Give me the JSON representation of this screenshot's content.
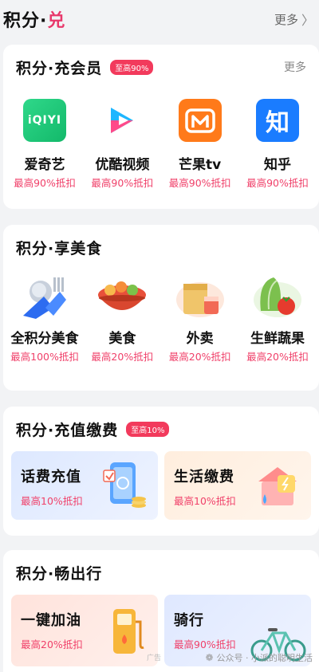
{
  "header": {
    "title_main": "积分·",
    "title_accent": "兑",
    "more": "更多"
  },
  "vip": {
    "title": "积分·充会员",
    "badge": "至高90%",
    "more": "更多",
    "items": [
      {
        "name": "爱奇艺",
        "sub": "最高90%抵扣",
        "icon": "iqiyi-logo",
        "logo_text": "iQIYI"
      },
      {
        "name": "优酷视频",
        "sub": "最高90%抵扣",
        "icon": "youku-logo"
      },
      {
        "name": "芒果tv",
        "sub": "最高90%抵扣",
        "icon": "mango-tv-logo"
      },
      {
        "name": "知乎",
        "sub": "最高90%抵扣",
        "icon": "zhihu-logo",
        "logo_text": "知"
      }
    ]
  },
  "food": {
    "title": "积分·享美食",
    "items": [
      {
        "name": "全积分美食",
        "sub": "最高100%抵扣",
        "icon": "spoon-fork-icon"
      },
      {
        "name": "美食",
        "sub": "最高20%抵扣",
        "icon": "food-bowl-icon"
      },
      {
        "name": "外卖",
        "sub": "最高20%抵扣",
        "icon": "takeout-bag-icon"
      },
      {
        "name": "生鲜蔬果",
        "sub": "最高20%抵扣",
        "icon": "vegetables-icon"
      }
    ]
  },
  "bills": {
    "title": "积分·充值缴费",
    "badge": "至高10%",
    "tiles": [
      {
        "name": "话费充值",
        "sub": "最高10%抵扣",
        "icon": "phone-recharge-icon"
      },
      {
        "name": "生活缴费",
        "sub": "最高10%抵扣",
        "icon": "house-bill-icon"
      }
    ]
  },
  "travel": {
    "title": "积分·畅出行",
    "tiles": [
      {
        "name": "一键加油",
        "sub": "最高20%抵扣",
        "icon": "gas-pump-icon"
      },
      {
        "name": "骑行",
        "sub": "最高90%抵扣",
        "icon": "bicycle-icon"
      }
    ],
    "ad_label": "广告",
    "watermark": "公众号 · 小派的聪明生活"
  },
  "colors": {
    "accent": "#f23a5c",
    "price_text": "#f0416a"
  }
}
